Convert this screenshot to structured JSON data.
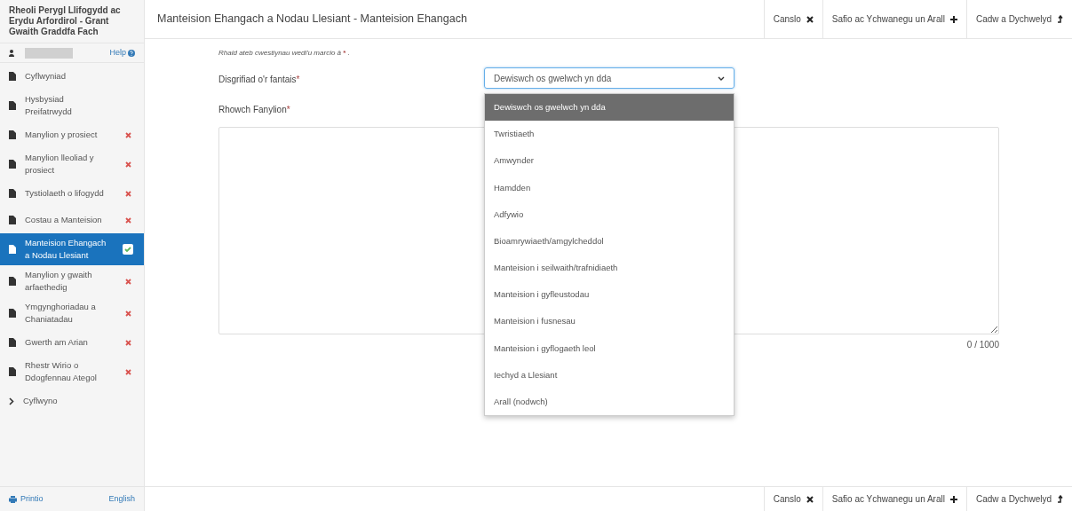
{
  "sidebar": {
    "title": "Rheoli Perygl Llifogydd ac Erydu Arfordirol - Grant Gwaith Graddfa Fach",
    "help": "Help",
    "items": [
      {
        "kind": "document",
        "label": "Cyflwyniad",
        "error": false,
        "complete": false,
        "selected": false
      },
      {
        "kind": "document",
        "label": "Hysbysiad Preifatrwydd",
        "error": false,
        "complete": false,
        "selected": false
      },
      {
        "kind": "document",
        "label": "Manylion y prosiect",
        "error": true,
        "complete": false,
        "selected": false
      },
      {
        "kind": "document",
        "label": "Manylion lleoliad y prosiect",
        "error": true,
        "complete": false,
        "selected": false
      },
      {
        "kind": "document",
        "label": "Tystiolaeth o lifogydd",
        "error": true,
        "complete": false,
        "selected": false
      },
      {
        "kind": "document",
        "label": "Costau a Manteision",
        "error": true,
        "complete": false,
        "selected": false
      },
      {
        "kind": "document",
        "label": "Manteision Ehangach a Nodau Llesiant",
        "error": false,
        "complete": true,
        "selected": true
      },
      {
        "kind": "document",
        "label": "Manylion y gwaith arfaethedig",
        "error": true,
        "complete": false,
        "selected": false
      },
      {
        "kind": "document",
        "label": "Ymgynghoriadau a Chaniatadau",
        "error": true,
        "complete": false,
        "selected": false
      },
      {
        "kind": "document",
        "label": "Gwerth am Arian",
        "error": true,
        "complete": false,
        "selected": false
      },
      {
        "kind": "document",
        "label": "Rhestr Wirio o Ddogfennau Ategol",
        "error": true,
        "complete": false,
        "selected": false
      },
      {
        "kind": "chevron",
        "label": "Cyflwyno",
        "error": false,
        "complete": false,
        "selected": false
      }
    ],
    "footer": {
      "print": "Printio",
      "language": "English"
    }
  },
  "header": {
    "title": "Manteision Ehangach a Nodau Llesiant - Manteision Ehangach"
  },
  "header_actions": [
    {
      "kind": "cancel",
      "label": "Canslo"
    },
    {
      "kind": "add",
      "label": "Safio ac Ychwanegu un Arall"
    },
    {
      "kind": "return",
      "label": "Cadw a Dychwelyd"
    }
  ],
  "footer_actions": [
    {
      "kind": "cancel",
      "label": "Canslo"
    },
    {
      "kind": "add",
      "label": "Safio ac Ychwanegu un Arall"
    },
    {
      "kind": "return",
      "label": "Cadw a Dychwelyd"
    }
  ],
  "form": {
    "note": "Rhaid ateb cwestiynau wedi'u marcio â",
    "note_mark": "*",
    "note_end": ".",
    "benefit": {
      "label": "Disgrifiad o'r fantais",
      "required": true,
      "value": "Dewiswch os gwelwch yn dda",
      "expanded": true,
      "options": [
        {
          "label": "Dewiswch os gwelwch yn dda",
          "selected": true
        },
        {
          "label": "Twristiaeth",
          "selected": false
        },
        {
          "label": "Amwynder",
          "selected": false
        },
        {
          "label": "Hamdden",
          "selected": false
        },
        {
          "label": "Adfywio",
          "selected": false
        },
        {
          "label": "Bioamrywiaeth/amgylcheddol",
          "selected": false
        },
        {
          "label": "Manteision i seilwaith/trafnidiaeth",
          "selected": false
        },
        {
          "label": "Manteision i gyfleustodau",
          "selected": false
        },
        {
          "label": "Manteision i fusnesau",
          "selected": false
        },
        {
          "label": "Manteision i gyflogaeth leol",
          "selected": false
        },
        {
          "label": "Iechyd a Llesiant",
          "selected": false
        },
        {
          "label": "Arall (nodwch)",
          "selected": false
        }
      ]
    },
    "details": {
      "label": "Rhowch Fanylion",
      "required": true,
      "counter": "0 / 1000"
    }
  }
}
